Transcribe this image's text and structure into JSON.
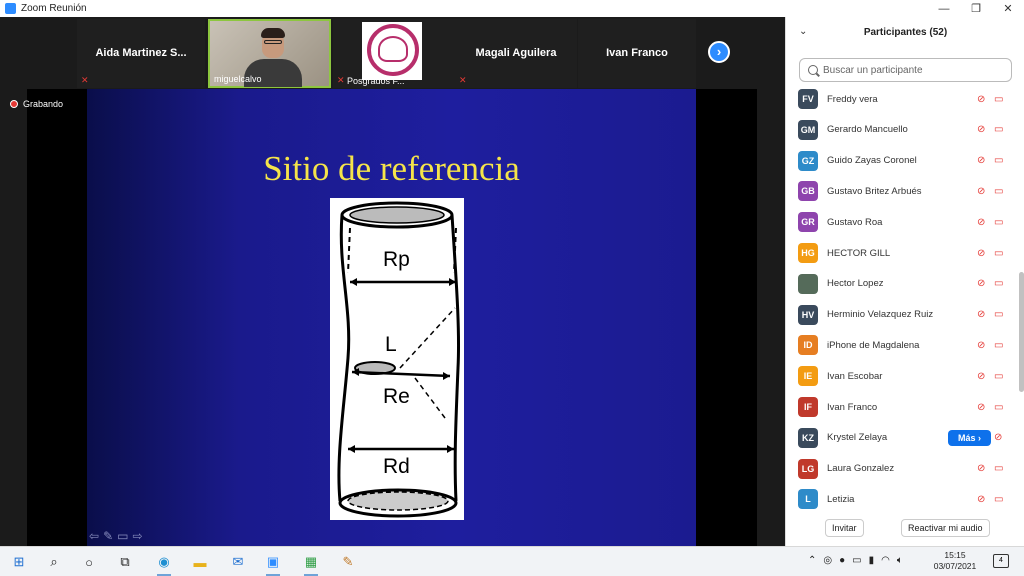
{
  "window": {
    "title": "Zoom Reunión",
    "min": "—",
    "restore": "❐",
    "close": "✕"
  },
  "strip": {
    "tiles": [
      {
        "name": "Aida  Martinez  S..."
      },
      {
        "label": "miguelcalvo"
      },
      {
        "label": "Posgrados F..."
      },
      {
        "name": "Magali Aguilera"
      },
      {
        "name": "Ivan Franco"
      }
    ],
    "next": "›"
  },
  "stage": {
    "recording": "Grabando",
    "slide_title": "Sitio de referencia",
    "figure_labels": {
      "rp": "Rp",
      "l": "L",
      "re": "Re",
      "rd": "Rd"
    }
  },
  "panel": {
    "title": "Participantes (52)",
    "search_placeholder": "Buscar un participante",
    "participants": [
      {
        "initials": "FV",
        "name": "Freddy vera",
        "color": "#3a4a5c"
      },
      {
        "initials": "GM",
        "name": "Gerardo Mancuello",
        "color": "#3a4a5c"
      },
      {
        "initials": "GZ",
        "name": "Guido Zayas Coronel",
        "color": "#2e8bc9"
      },
      {
        "initials": "GB",
        "name": "Gustavo Britez Arbués",
        "color": "#8e44ad"
      },
      {
        "initials": "GR",
        "name": "Gustavo Roa",
        "color": "#8e44ad"
      },
      {
        "initials": "HG",
        "name": "HECTOR GILL",
        "color": "#f39c12"
      },
      {
        "initials": "",
        "name": "Hector Lopez",
        "color": "#556b5a"
      },
      {
        "initials": "HV",
        "name": "Herminio Velazquez Ruiz",
        "color": "#3a4a5c"
      },
      {
        "initials": "ID",
        "name": "iPhone de Magdalena",
        "color": "#e67e22"
      },
      {
        "initials": "IE",
        "name": "Ivan Escobar",
        "color": "#f39c12"
      },
      {
        "initials": "IF",
        "name": "Ivan Franco",
        "color": "#c0392b"
      },
      {
        "initials": "KZ",
        "name": "Krystel Zelaya",
        "color": "#3a4a5c"
      },
      {
        "initials": "LG",
        "name": "Laura Gonzalez",
        "color": "#c0392b"
      },
      {
        "initials": "L",
        "name": "Letizia",
        "color": "#2e8bc9"
      }
    ],
    "more_label": "Más ›",
    "invite_label": "Invitar",
    "unmute_label": "Reactivar mi audio"
  },
  "taskbar": {
    "time": "15:15",
    "date": "03/07/2021",
    "notifications": "4"
  }
}
